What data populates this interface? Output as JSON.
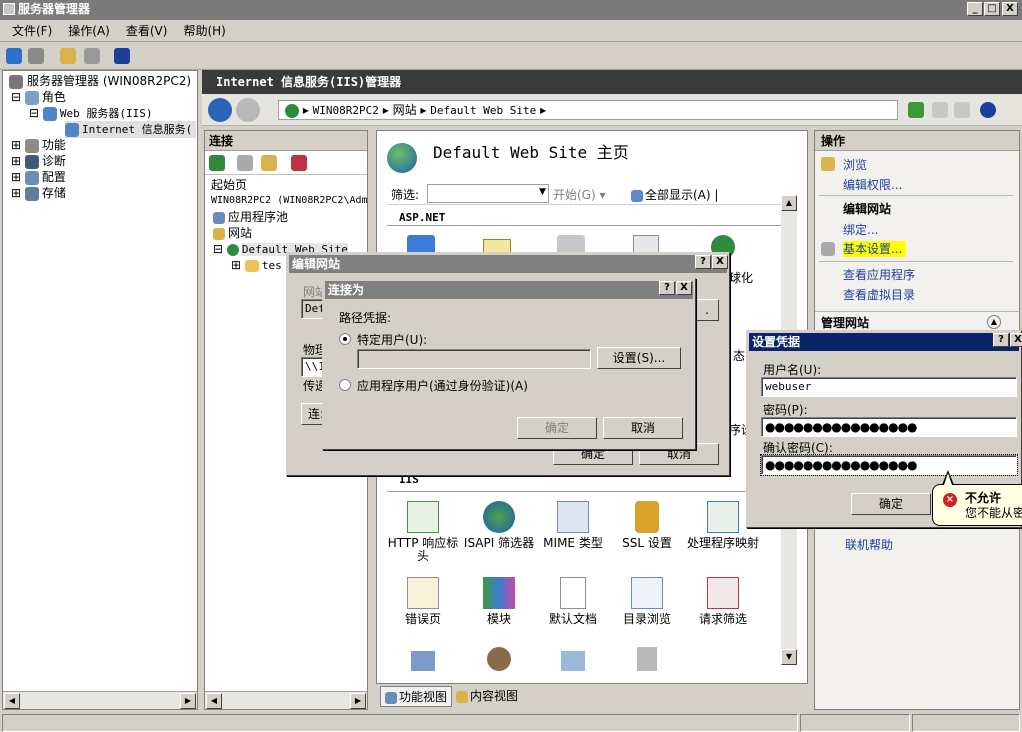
{
  "window": {
    "title": "服务器管理器",
    "min": "_",
    "max": "□",
    "close": "X"
  },
  "menu": [
    "文件(F)",
    "操作(A)",
    "查看(V)",
    "帮助(H)"
  ],
  "tree": {
    "root": "服务器管理器 (WIN08R2PC2)",
    "roles": "角色",
    "web": "Web 服务器(IIS)",
    "iis": "Internet 信息服务(",
    "features": "功能",
    "diagnostics": "诊断",
    "config": "配置",
    "storage": "存储"
  },
  "iis_header": "Internet 信息服务(IIS)管理器",
  "address": {
    "server": "WIN08R2PC2",
    "sites": "网站",
    "site": "Default Web Site"
  },
  "connections": {
    "title": "连接",
    "start": "起始页",
    "server": "WIN08R2PC2 (WIN08R2PC2\\Adm",
    "apppools": "应用程序池",
    "sites": "网站",
    "site": "Default Web Site",
    "child": "tes"
  },
  "main": {
    "title": "Default Web Site 主页",
    "filter_label": "筛选:",
    "go_label": "开始(G)",
    "showall_label": "全部显示(A)",
    "group_aspnet": "ASP.NET",
    "group_iis": "IIS",
    "partial_text1": "球化",
    "partial_text2": "态",
    "partial_text3": "序设",
    "features_row1": [
      "HTTP 响应标头",
      "ISAPI 筛选器",
      "MIME 类型",
      "SSL 设置",
      "处理程序映射"
    ],
    "features_row2": [
      "错误页",
      "模块",
      "默认文档",
      "目录浏览",
      "请求筛选"
    ],
    "tab_features": "功能视图",
    "tab_content": "内容视图"
  },
  "actions": {
    "title": "操作",
    "browse": "浏览",
    "edit_perm": "编辑权限...",
    "edit_site": "编辑网站",
    "bindings": "绑定...",
    "basic": "基本设置...",
    "view_apps": "查看应用程序",
    "view_vdirs": "查看虚拟目录",
    "manage": "管理网站",
    "help": "联机帮助"
  },
  "dlg_edit": {
    "title": "编辑网站",
    "lbl_site": "网站",
    "site_val": "Def",
    "lbl_phys": "物理",
    "phys_val": "\\\\1",
    "lbl_pass": "传递",
    "connect_btn": "连:",
    "ok": "确定",
    "cancel": "取消"
  },
  "dlg_connect": {
    "title": "连接为",
    "section": "路径凭据:",
    "specific": "特定用户(U):",
    "set_btn": "设置(S)...",
    "appuser": "应用程序用户(通过身份验证)(A)",
    "ok": "确定",
    "cancel": "取消"
  },
  "dlg_cred": {
    "title": "设置凭据",
    "user_label": "用户名(U):",
    "user_val": "webuser",
    "pw_label": "密码(P):",
    "pw_val": "●●●●●●●●●●●●●●●●",
    "confirm_label": "确认密码(C):",
    "confirm_val": "●●●●●●●●●●●●●●●●",
    "ok": "确定"
  },
  "tooltip": {
    "title": "不允许",
    "text": "您不能从密"
  },
  "help_btn": "?",
  "close_btn": "X"
}
